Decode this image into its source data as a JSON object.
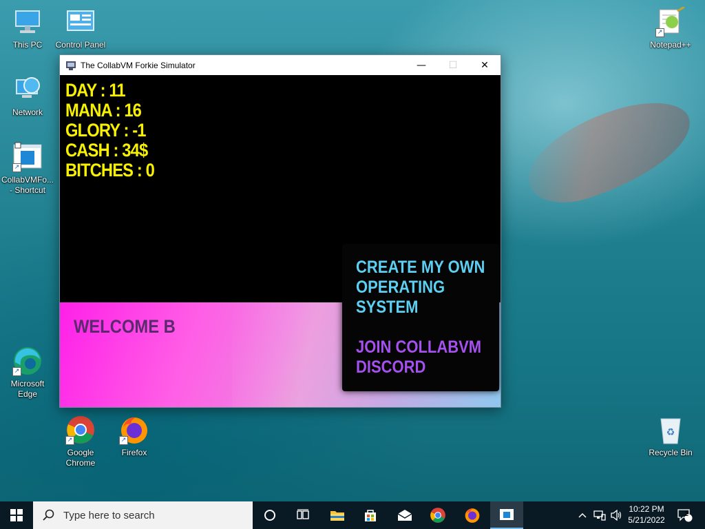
{
  "desktop": {
    "icons": [
      {
        "label": "This PC"
      },
      {
        "label": "Control Panel"
      },
      {
        "label": "Network"
      },
      {
        "label": "CollabVMFo... - Shortcut"
      },
      {
        "label": "Microsoft Edge"
      },
      {
        "label": "Google Chrome"
      },
      {
        "label": "Firefox"
      },
      {
        "label": "Notepad++"
      },
      {
        "label": "Recycle Bin"
      }
    ]
  },
  "window": {
    "title": "The CollabVM Forkie Simulator",
    "controls": {
      "minimize": "—",
      "maximize": "☐",
      "close": "✕"
    }
  },
  "game": {
    "stats": [
      "DAY : 11",
      "MANA : 16",
      "GLORY : -1",
      "CASH : 34$",
      "BITCHES : 0"
    ],
    "welcome_text": "WELCOME B",
    "menu": {
      "create_os_line1": "CREATE MY OWN",
      "create_os_line2": "OPERATING",
      "create_os_line3": "SYSTEM",
      "discord_line1": "JOIN COLLABVM",
      "discord_line2": "DISCORD"
    },
    "colors": {
      "stats": "#f7f000",
      "create_button": "#5ccff2",
      "discord_button": "#a550ef",
      "welcome_text": "#5a2a6e"
    }
  },
  "taskbar": {
    "search_placeholder": "Type here to search",
    "pinned": [
      "task-view-icon",
      "file-explorer-icon",
      "microsoft-store-icon",
      "mail-icon",
      "chrome-icon",
      "firefox-icon",
      "collabvm-app-icon"
    ],
    "clock_time": "10:22 PM",
    "clock_date": "5/21/2022",
    "notification_count": "2"
  }
}
